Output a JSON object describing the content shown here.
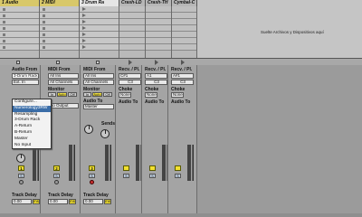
{
  "tracks": [
    {
      "name": "1 Audio",
      "style": "a",
      "number": "1",
      "delay": "0.00"
    },
    {
      "name": "2 MIDI",
      "style": "a",
      "number": "2",
      "delay": "0.00"
    },
    {
      "name": "3 Drum Ra",
      "style": "sel",
      "number": "3",
      "delay": "0.00"
    },
    {
      "name": "Crash-LD",
      "style": "g"
    },
    {
      "name": "Crash-TH",
      "style": "g"
    },
    {
      "name": "Cymbal-C",
      "style": "g"
    }
  ],
  "dropzone_text": "Suelte Archivos y Dispositivos aquí",
  "io": {
    "audio_from_label": "Audio From",
    "audio_from_value": "3-Drum Rack",
    "ext_in": "Ext. In",
    "midi_from_label": "MIDI From",
    "midi_from_value": "All Ins",
    "all_channels": "All Channels",
    "monitor_label": "Monitor",
    "monitor_in": "In",
    "monitor_auto": "Auto",
    "monitor_off": "Off",
    "audio_to_label": "Audio To",
    "audio_to_value": "Master",
    "midi_to_value": "No Output",
    "recv_label": "Recv. / Pl.",
    "recv_values": [
      "C#1",
      "A1",
      "A#1"
    ],
    "recv_notes": [
      "C3",
      "C3",
      "C3"
    ],
    "choke_label": "Choke",
    "choke_value": "None",
    "audio_to_short": "Audio To",
    "sends_label": "Sends",
    "sends_knob_letter": "A",
    "solo_label": "S",
    "track_delay_label": "Track Delay",
    "ms_label": "ms"
  },
  "menu": {
    "items": [
      "Configure...",
      "Numerology3RW",
      "Resampling",
      "3-Drum Rack",
      "A-Return",
      "B-Return",
      "Master",
      "No Input"
    ],
    "highlighted_index": 1
  }
}
